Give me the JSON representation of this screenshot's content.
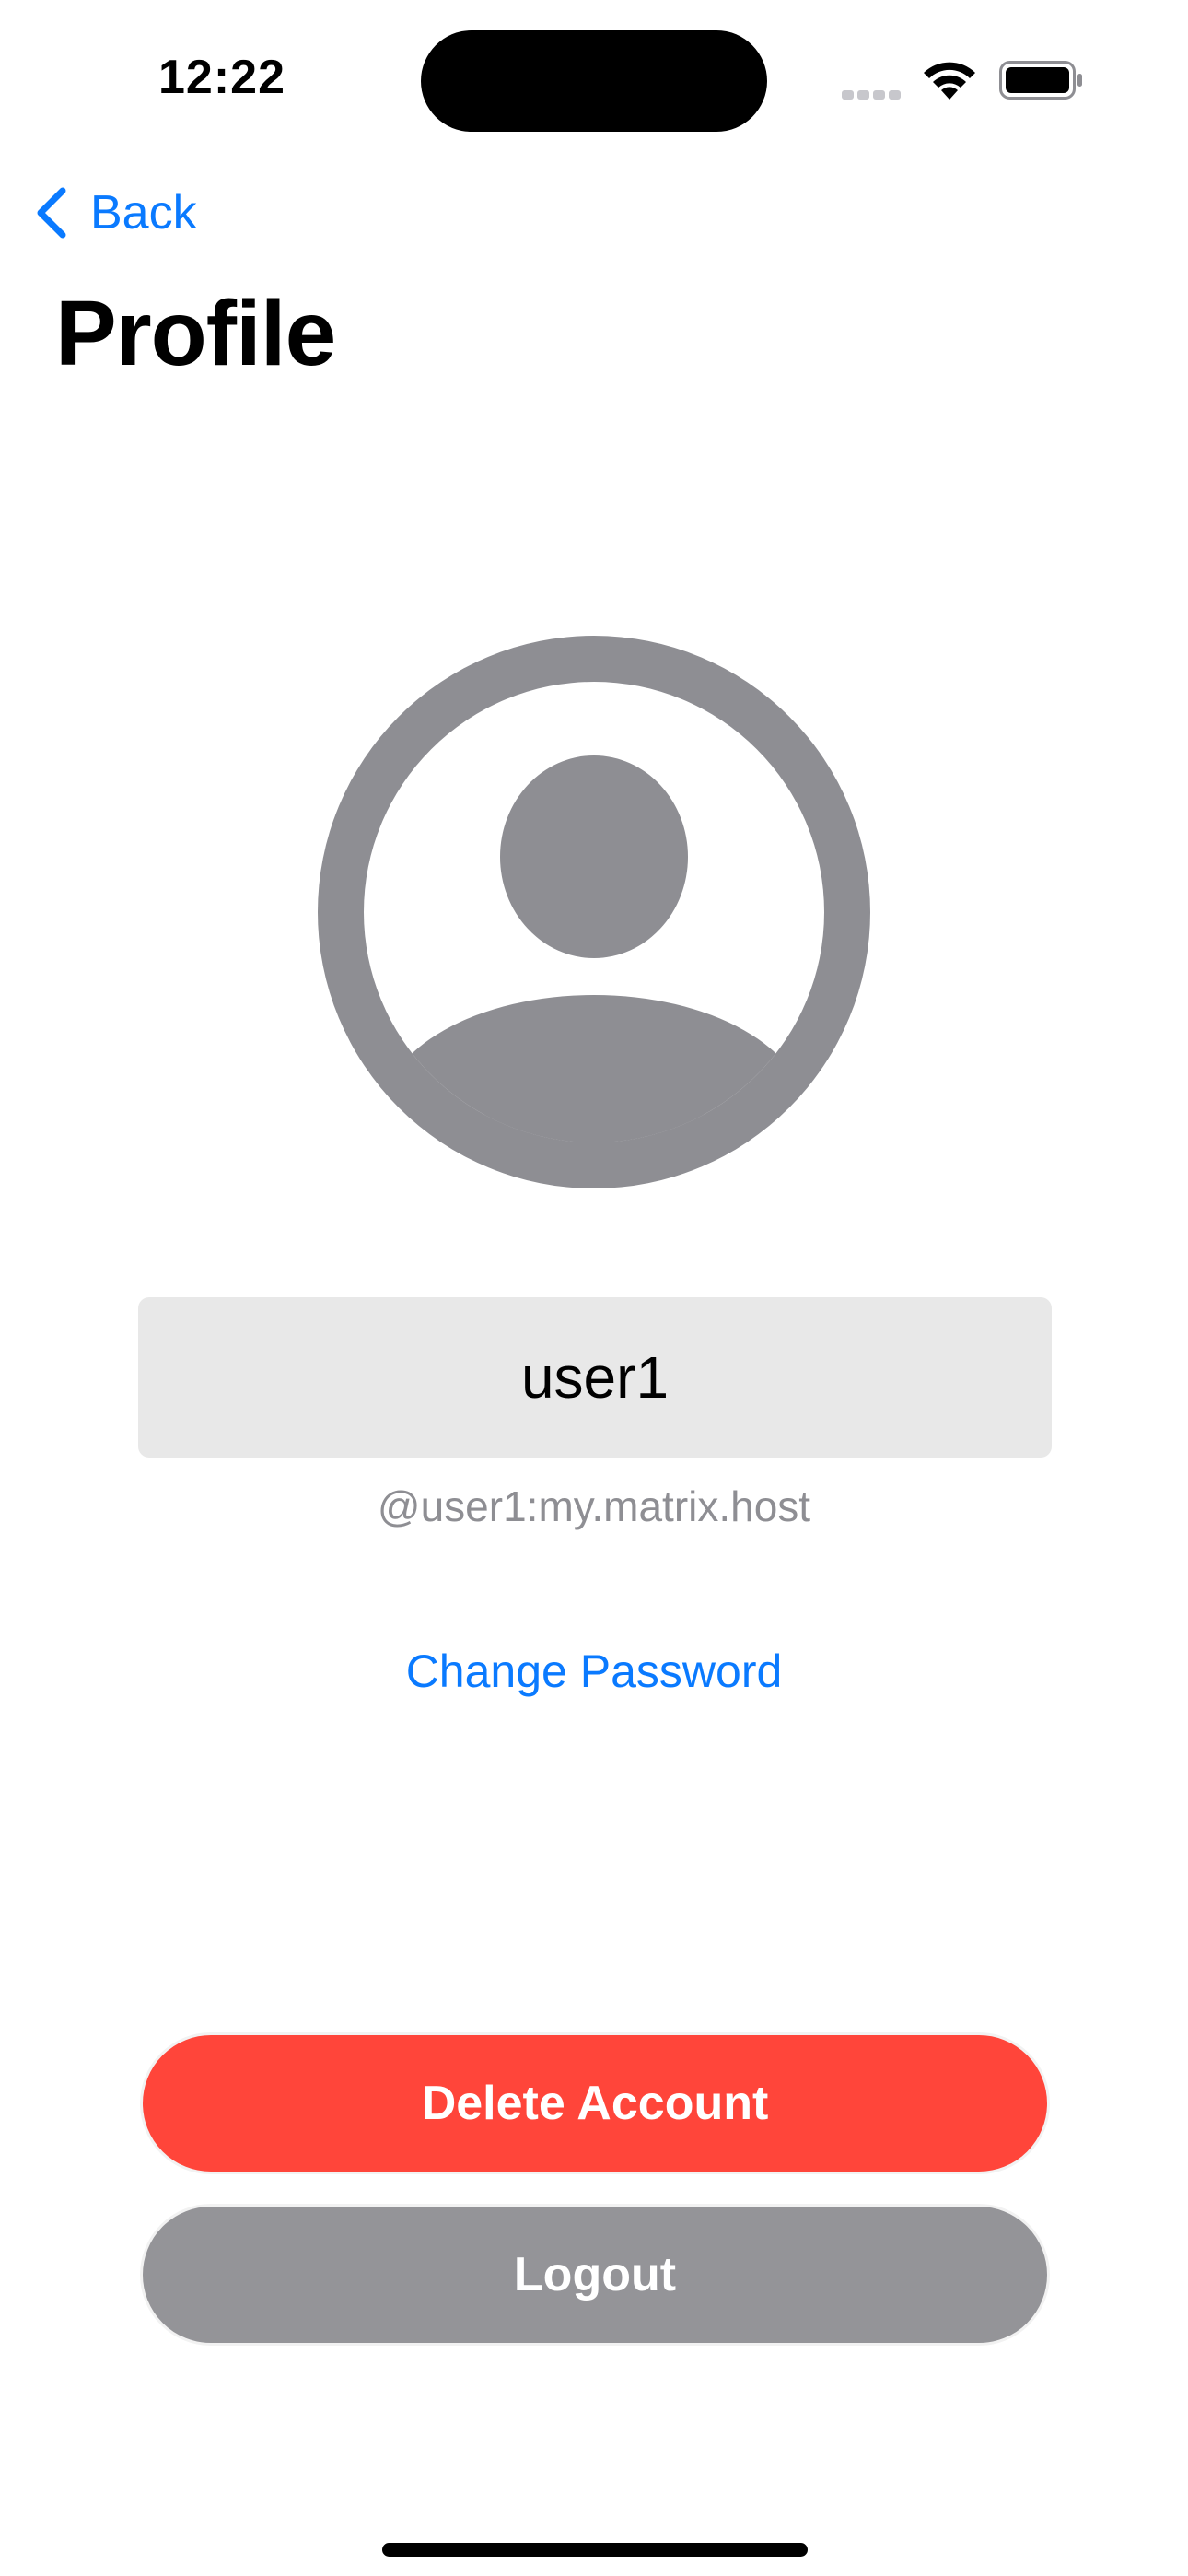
{
  "status_bar": {
    "time": "12:22"
  },
  "nav": {
    "back_label": "Back"
  },
  "page": {
    "title": "Profile"
  },
  "profile": {
    "display_name": "user1",
    "user_id": "@user1:my.matrix.host",
    "avatar_icon": "person-circle-icon"
  },
  "actions": {
    "change_password_label": "Change Password",
    "delete_account_label": "Delete Account",
    "logout_label": "Logout"
  },
  "colors": {
    "accent": "#0a7aff",
    "destructive": "#ff453a",
    "secondary_button": "#949498",
    "avatar_gray": "#8e8e93",
    "field_background": "#e8e8e8"
  }
}
